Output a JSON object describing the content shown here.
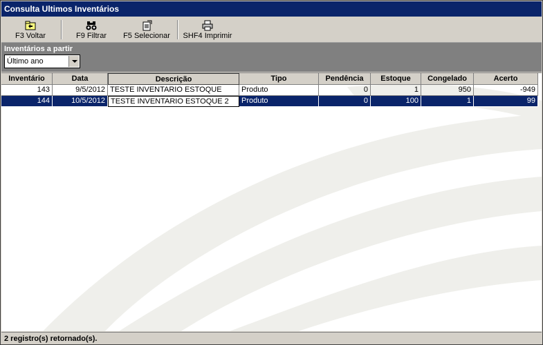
{
  "window": {
    "title": "Consulta Ultimos Inventários"
  },
  "toolbar": {
    "items": [
      {
        "label": "F3 Voltar",
        "icon": "back-folder-icon"
      },
      {
        "label": "F9 Filtrar",
        "icon": "binoculars-icon"
      },
      {
        "label": "F5 Selecionar",
        "icon": "select-doc-icon"
      },
      {
        "label": "SHF4 Imprimir",
        "icon": "printer-icon"
      }
    ]
  },
  "filter": {
    "label": "Inventários a partir",
    "selected": "Último ano"
  },
  "table": {
    "columns": [
      "Inventário",
      "Data",
      "Descrição",
      "Tipo",
      "Pendência",
      "Estoque",
      "Congelado",
      "Acerto"
    ],
    "rows": [
      [
        "143",
        "9/5/2012",
        "TESTE INVENTARIO ESTOQUE",
        "Produto",
        "0",
        "1",
        "950",
        "-949"
      ],
      [
        "144",
        "10/5/2012",
        "TESTE INVENTARIO ESTOQUE 2",
        "Produto",
        "0",
        "100",
        "1",
        "99"
      ]
    ],
    "selected_row": 1
  },
  "status": {
    "text": "2 registro(s) retornado(s)."
  },
  "colors": {
    "title_bg": "#0a246a",
    "selection": "#0a246a",
    "panel": "#d4d0c8"
  }
}
